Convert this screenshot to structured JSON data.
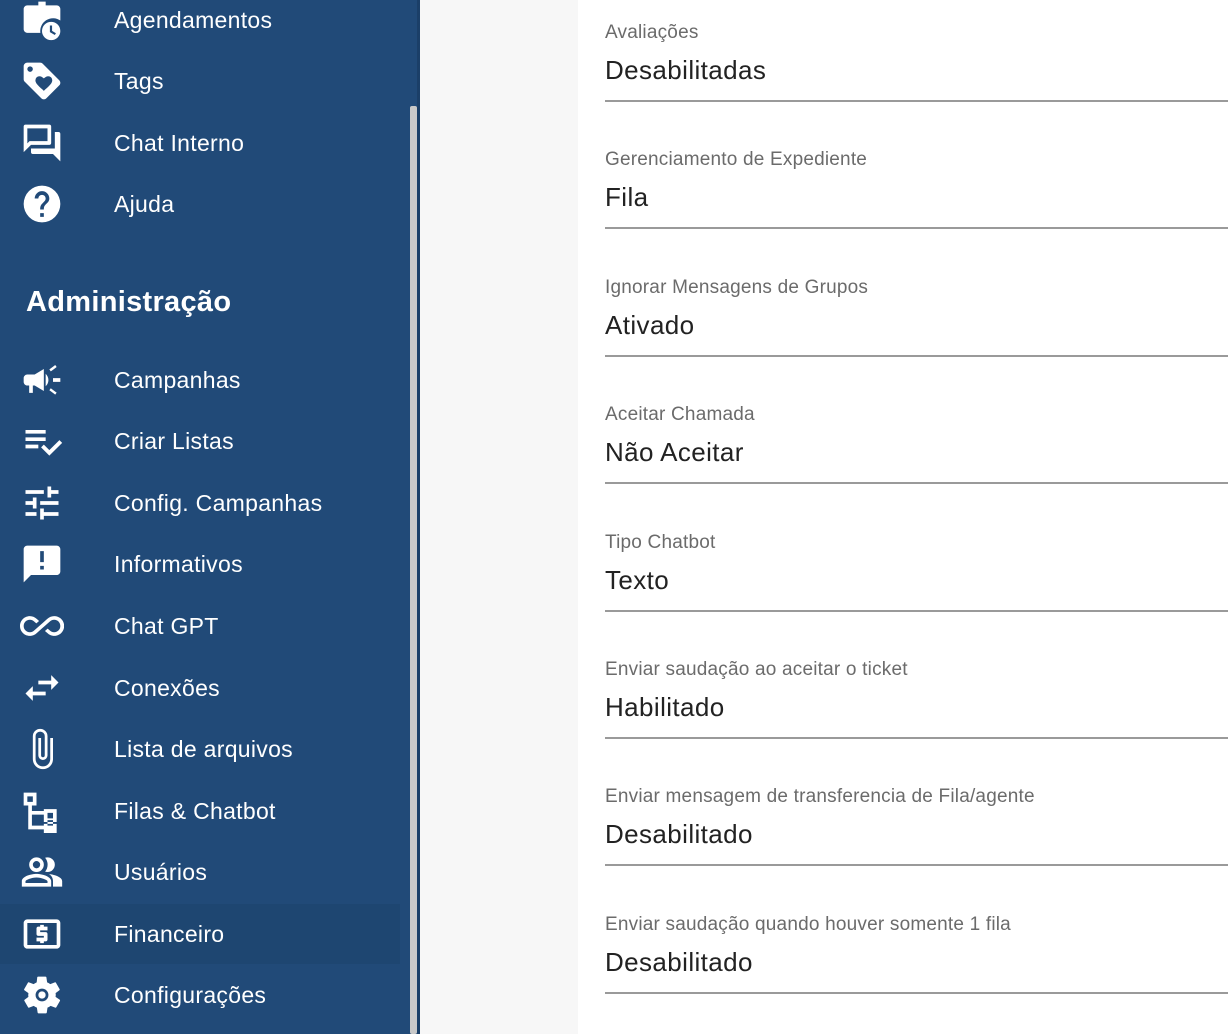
{
  "sidebar": {
    "items_top": [
      {
        "label": "Agendamentos",
        "icon": "calendar-clock-icon"
      },
      {
        "label": "Tags",
        "icon": "tag-heart-icon"
      },
      {
        "label": "Chat Interno",
        "icon": "forum-icon"
      },
      {
        "label": "Ajuda",
        "icon": "help-circle-icon"
      }
    ],
    "section_title": "Administração",
    "items_admin": [
      {
        "label": "Campanhas",
        "icon": "megaphone-icon"
      },
      {
        "label": "Criar Listas",
        "icon": "playlist-check-icon"
      },
      {
        "label": "Config. Campanhas",
        "icon": "tune-icon"
      },
      {
        "label": "Informativos",
        "icon": "announcement-icon"
      },
      {
        "label": "Chat GPT",
        "icon": "infinity-icon"
      },
      {
        "label": "Conexões",
        "icon": "swap-arrows-icon"
      },
      {
        "label": "Lista de arquivos",
        "icon": "paperclip-icon"
      },
      {
        "label": "Filas & Chatbot",
        "icon": "hierarchy-icon"
      },
      {
        "label": "Usuários",
        "icon": "people-icon"
      },
      {
        "label": "Financeiro",
        "icon": "money-icon"
      },
      {
        "label": "Configurações",
        "icon": "gear-icon"
      }
    ],
    "active_item": "Financeiro"
  },
  "settings": [
    {
      "label": "Avaliações",
      "value": "Desabilitadas"
    },
    {
      "label": "Gerenciamento de Expediente",
      "value": "Fila"
    },
    {
      "label": "Ignorar Mensagens de Grupos",
      "value": "Ativado"
    },
    {
      "label": "Aceitar Chamada",
      "value": "Não Aceitar"
    },
    {
      "label": "Tipo Chatbot",
      "value": "Texto"
    },
    {
      "label": "Enviar saudação ao aceitar o ticket",
      "value": "Habilitado"
    },
    {
      "label": "Enviar mensagem de transferencia de Fila/agente",
      "value": "Desabilitado"
    },
    {
      "label": "Enviar saudação quando houver somente 1 fila",
      "value": "Desabilitado"
    }
  ],
  "colors": {
    "sidebar_bg": "#214a78",
    "active_item_bg": "#1e4671",
    "icon_color": "#ffffff",
    "label_color": "#6b6b6b",
    "value_color": "#222222"
  }
}
